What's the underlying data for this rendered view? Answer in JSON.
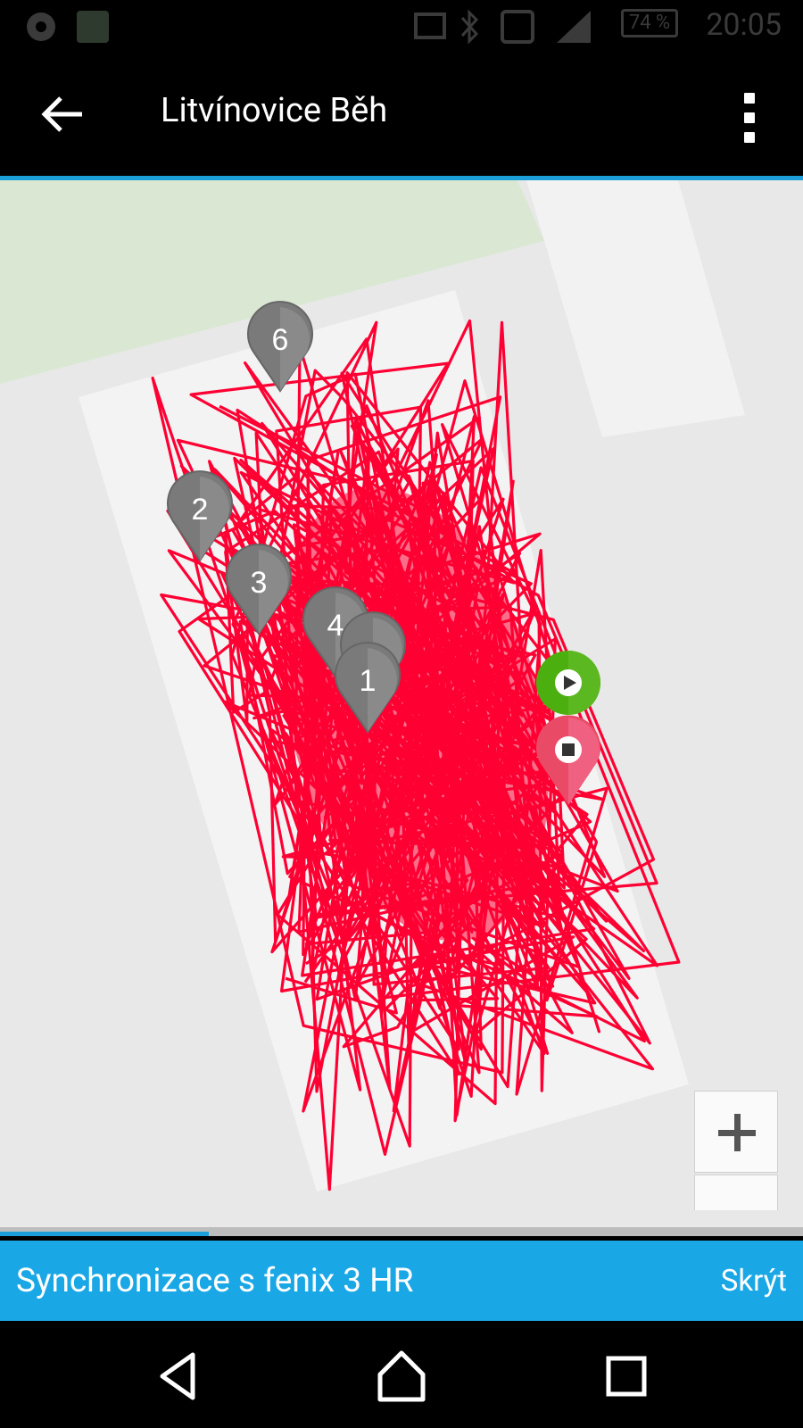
{
  "status_bar": {
    "time": "20:05",
    "battery": "74 %",
    "icons": [
      "aperture-icon",
      "notification-app-icon",
      "cast-icon",
      "bluetooth-icon",
      "nfc-icon",
      "lte-signal-icon"
    ]
  },
  "app_bar": {
    "title": "Litvínovice Běh",
    "back_icon": "arrow-left-icon",
    "menu_icon": "more-vert-icon"
  },
  "map": {
    "markers": [
      {
        "label": "6"
      },
      {
        "label": "2"
      },
      {
        "label": "3"
      },
      {
        "label": "4"
      },
      {
        "label": "-"
      },
      {
        "label": "1"
      }
    ],
    "start_marker_icon": "play-icon",
    "end_marker_icon": "stop-icon",
    "track_color": "#ff0033",
    "zoom_in_label": "+"
  },
  "sync": {
    "progress_percent": 26,
    "message": "Synchronizace s fenix 3 HR",
    "hide_label": "Skrýt"
  },
  "nav_bar": {
    "icons": [
      "nav-back-icon",
      "nav-home-icon",
      "nav-recents-icon"
    ]
  },
  "colors": {
    "accent": "#1aa7e5",
    "track": "#ff0033",
    "start_marker": "#4caf10",
    "end_marker": "#e94a66",
    "lap_marker": "#7a7a7a"
  }
}
